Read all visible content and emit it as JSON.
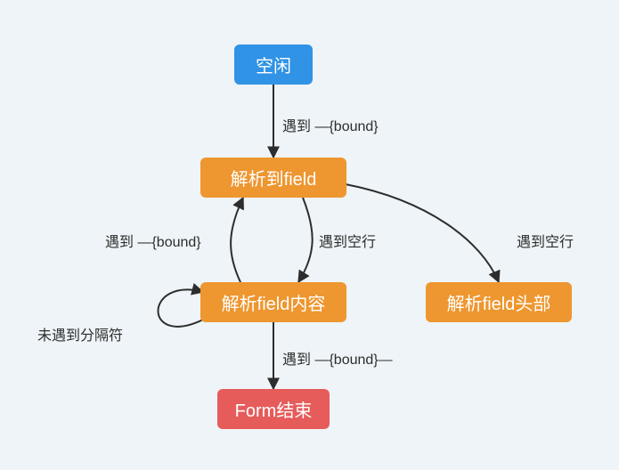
{
  "nodes": {
    "idle": {
      "text": "空闲"
    },
    "parse_field": {
      "text": "解析到field"
    },
    "parse_content": {
      "text": "解析field内容"
    },
    "parse_header": {
      "text": "解析field头部"
    },
    "form_end": {
      "text": "Form结束"
    }
  },
  "edges": {
    "idle_to_parse": {
      "label": "遇到 —{bound}"
    },
    "parse_to_content_r": {
      "label": "遇到空行"
    },
    "content_to_parse_l": {
      "label": "遇到 —{bound}"
    },
    "parse_to_header": {
      "label": "遇到空行"
    },
    "self_content": {
      "label": "未遇到分隔符"
    },
    "content_to_end": {
      "label": "遇到 —{bound}—"
    }
  },
  "colors": {
    "blue": "#3093e5",
    "orange": "#ee962f",
    "red": "#e65c5b",
    "bg": "#eef4f7",
    "stroke": "#2d2d2d"
  }
}
